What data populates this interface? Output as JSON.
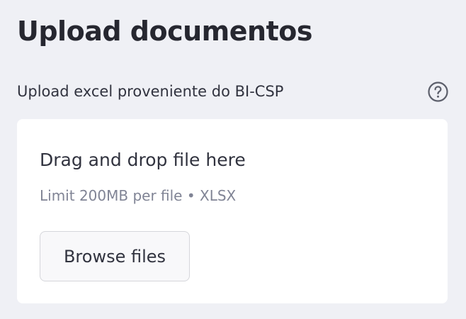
{
  "header": {
    "title": "Upload documentos"
  },
  "uploader": {
    "label": "Upload excel proveniente do BI-CSP",
    "help_icon": "help-circle-icon",
    "drop_title": "Drag and drop file here",
    "limit_text": "Limit 200MB per file • XLSX",
    "browse_label": "Browse files"
  },
  "colors": {
    "page_background": "#eff0f5",
    "dropzone_background": "#ffffff",
    "text": "#31333f",
    "muted_text": "#808495",
    "button_border": "#d5d6db"
  }
}
